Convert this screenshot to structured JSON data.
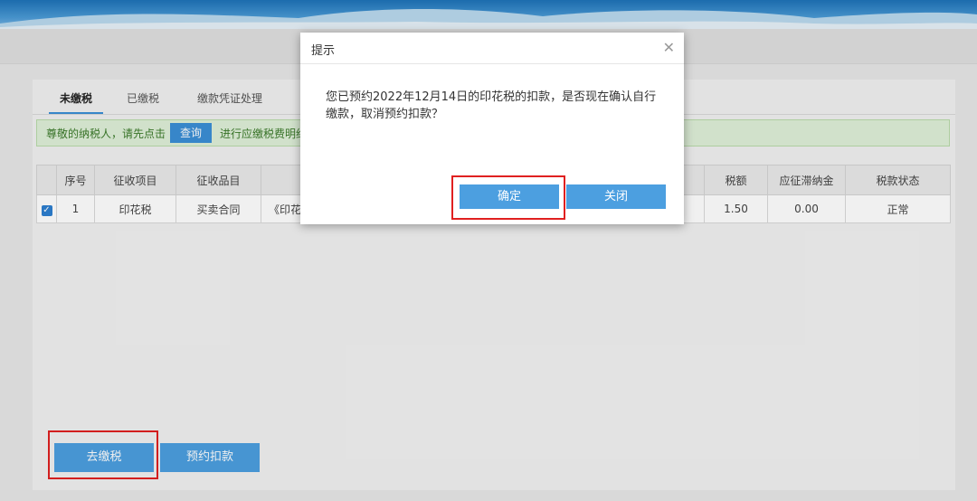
{
  "tabs": [
    "未缴税",
    "已缴税",
    "缴款凭证处理"
  ],
  "notice": {
    "prefix": "尊敬的纳税人，请先点击",
    "query_label": "查询",
    "suffix": "进行应缴税费明细"
  },
  "table": {
    "headers": [
      "",
      "序号",
      "征收项目",
      "征收品目",
      "",
      "",
      "税额",
      "应征滞纳金",
      "税款状态"
    ],
    "rows": [
      {
        "checked": true,
        "index": "1",
        "item": "印花税",
        "category": "买卖合同",
        "desc": "《印花",
        "amount": "1.50",
        "late_fee": "0.00",
        "status": "正常"
      }
    ]
  },
  "buttons": {
    "pay": "去缴税",
    "schedule": "预约扣款"
  },
  "dialog": {
    "title": "提示",
    "message": "您已预约2022年12月14日的印花税的扣款，是否现在确认自行缴款，取消预约扣款？",
    "confirm": "确定",
    "close": "关闭"
  },
  "colors": {
    "primary": "#4c9fe0",
    "highlight": "#e02020",
    "notice_bg": "#dff0d8"
  }
}
